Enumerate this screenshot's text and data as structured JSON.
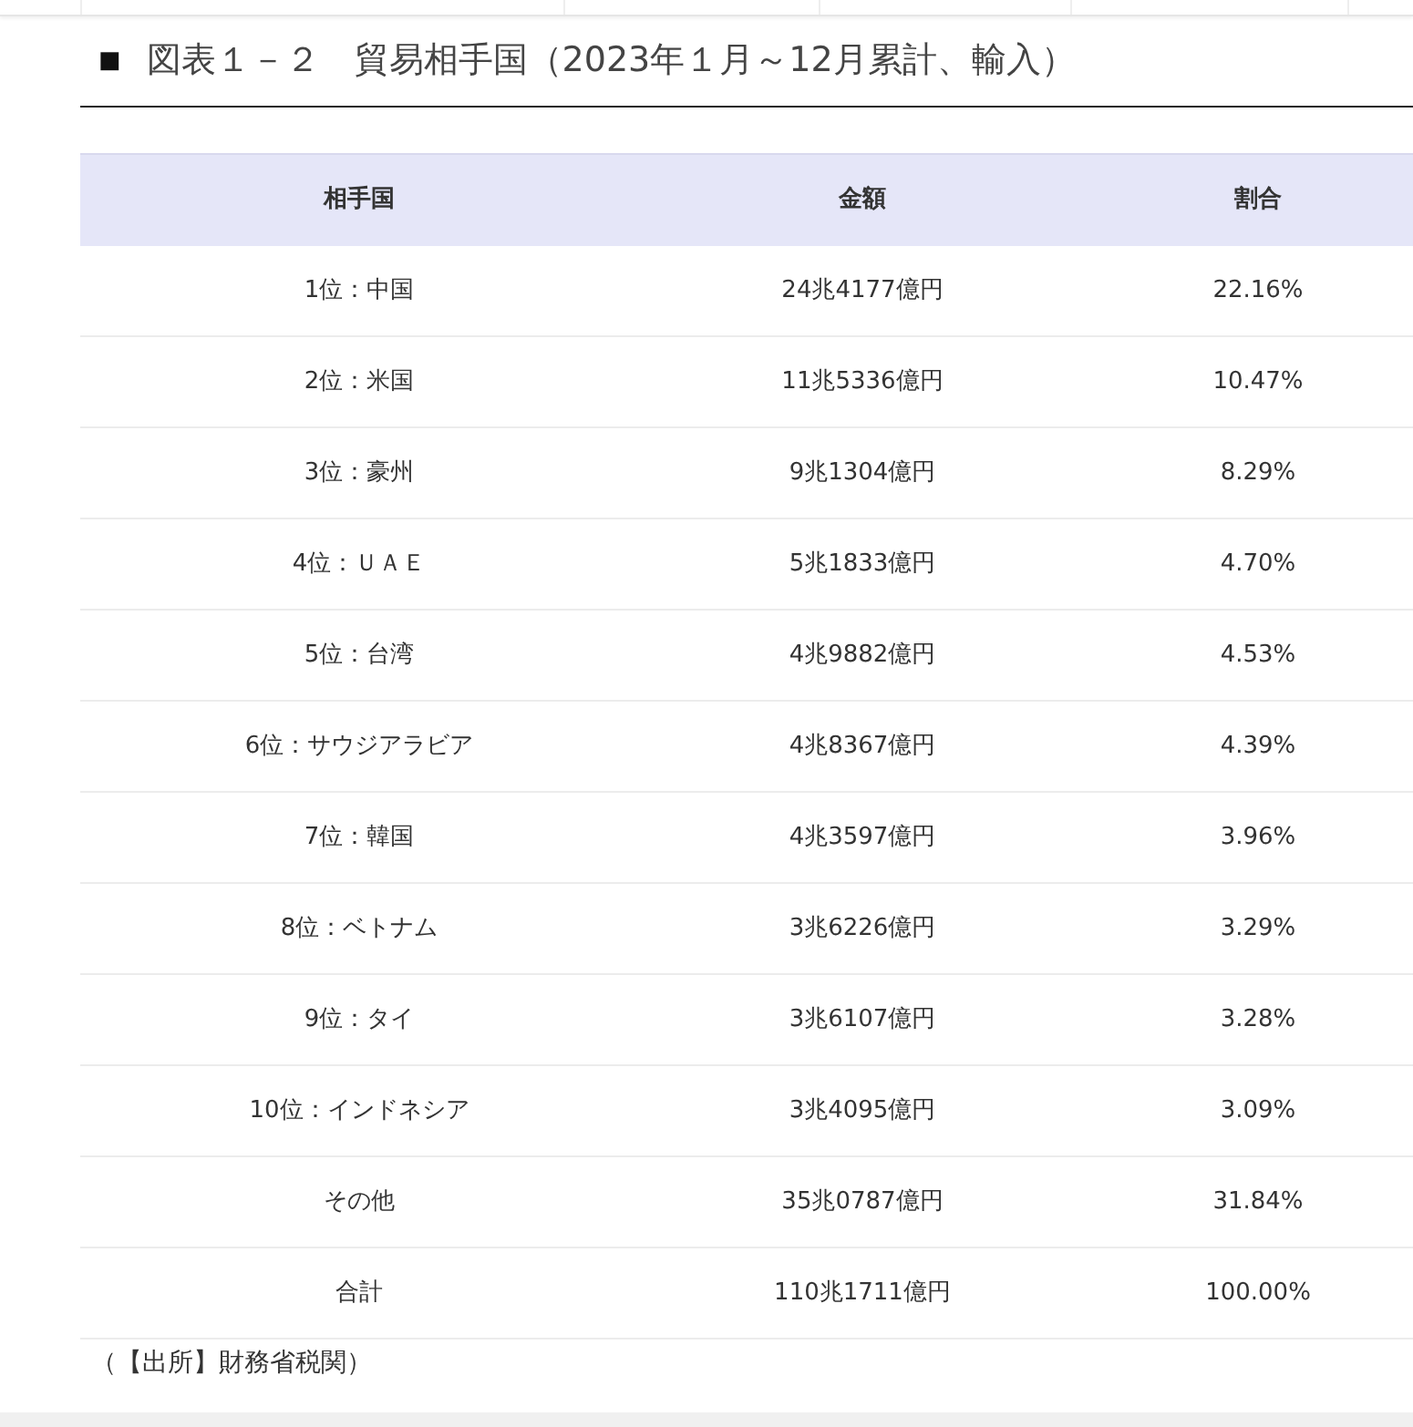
{
  "heading": {
    "marker": "■",
    "title": "図表１－２　貿易相手国（2023年１月～12月累計、輸入）"
  },
  "table": {
    "columns": [
      "相手国",
      "金額",
      "割合"
    ],
    "rows": [
      [
        "1位：中国",
        "24兆4177億円",
        "22.16%"
      ],
      [
        "2位：米国",
        "11兆5336億円",
        "10.47%"
      ],
      [
        "3位：豪州",
        "9兆1304億円",
        "8.29%"
      ],
      [
        "4位：ＵＡＥ",
        "5兆1833億円",
        "4.70%"
      ],
      [
        "5位：台湾",
        "4兆9882億円",
        "4.53%"
      ],
      [
        "6位：サウジアラビア",
        "4兆8367億円",
        "4.39%"
      ],
      [
        "7位：韓国",
        "4兆3597億円",
        "3.96%"
      ],
      [
        "8位：ベトナム",
        "3兆6226億円",
        "3.29%"
      ],
      [
        "9位：タイ",
        "3兆6107億円",
        "3.28%"
      ],
      [
        "10位：インドネシア",
        "3兆4095億円",
        "3.09%"
      ],
      [
        "その他",
        "35兆0787億円",
        "31.84%"
      ],
      [
        "合計",
        "110兆1711億円",
        "100.00%"
      ]
    ]
  },
  "source": "（【出所】財務省税関）"
}
